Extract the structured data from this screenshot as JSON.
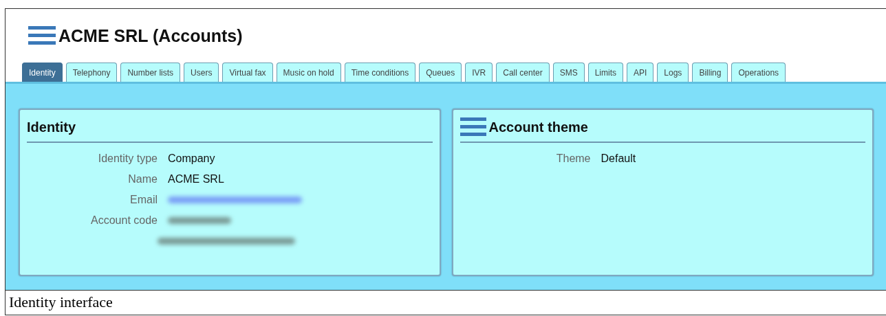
{
  "header": {
    "title": "ACME SRL (Accounts)"
  },
  "tabs": [
    {
      "label": "Identity",
      "selected": true
    },
    {
      "label": "Telephony",
      "selected": false
    },
    {
      "label": "Number lists",
      "selected": false
    },
    {
      "label": "Users",
      "selected": false
    },
    {
      "label": "Virtual fax",
      "selected": false
    },
    {
      "label": "Music on hold",
      "selected": false
    },
    {
      "label": "Time conditions",
      "selected": false
    },
    {
      "label": "Queues",
      "selected": false
    },
    {
      "label": "IVR",
      "selected": false
    },
    {
      "label": "Call center",
      "selected": false
    },
    {
      "label": "SMS",
      "selected": false
    },
    {
      "label": "Limits",
      "selected": false
    },
    {
      "label": "API",
      "selected": false
    },
    {
      "label": "Logs",
      "selected": false
    },
    {
      "label": "Billing",
      "selected": false
    },
    {
      "label": "Operations",
      "selected": false
    }
  ],
  "panels": [
    {
      "title": "Identity",
      "menu_icon": false,
      "fields": [
        {
          "kind": "text",
          "label": "Identity type",
          "value": "Company"
        },
        {
          "kind": "text",
          "label": "Name",
          "value": "ACME SRL"
        },
        {
          "kind": "redacted_link",
          "label": "Email"
        },
        {
          "kind": "redacted_text",
          "label": "Account code"
        },
        {
          "kind": "redacted_wide"
        }
      ]
    },
    {
      "title": "Account theme",
      "menu_icon": true,
      "fields": [
        {
          "kind": "text",
          "label": "Theme",
          "value": "Default"
        }
      ]
    }
  ],
  "caption": "Identity interface"
}
